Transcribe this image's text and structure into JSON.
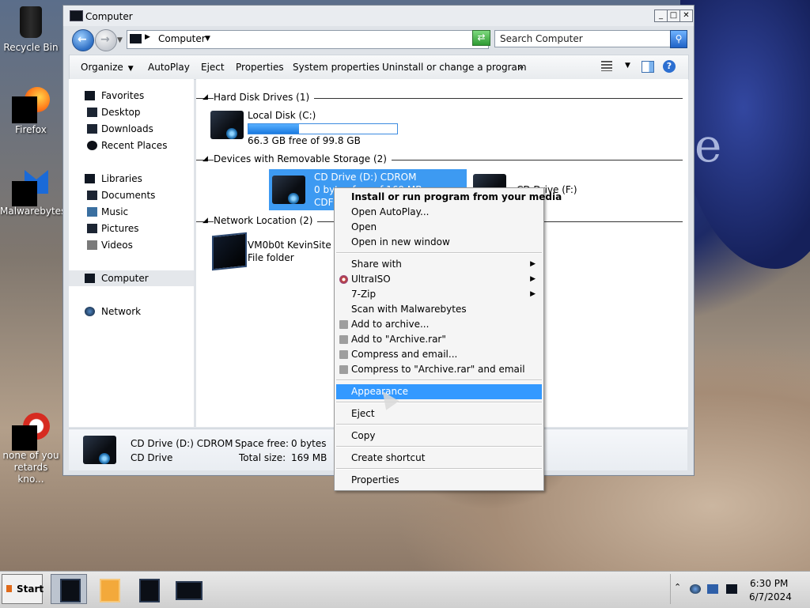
{
  "desktop": {
    "icons": [
      {
        "label": "Recycle Bin"
      },
      {
        "label": "Firefox"
      },
      {
        "label": "Malwarebytes"
      },
      {
        "label": "none of you retards kno..."
      }
    ]
  },
  "window": {
    "title": "Computer",
    "controls": {
      "minimize": "_",
      "maximize": "□",
      "close": "✕"
    },
    "address": {
      "crumb": "Computer"
    },
    "search": {
      "placeholder": "Search Computer"
    },
    "commandbar": {
      "items": [
        "Organize",
        "AutoPlay",
        "Eject",
        "Properties",
        "System properties",
        "Uninstall or change a program"
      ],
      "overflow": "»"
    },
    "navpane": {
      "favorites": "Favorites",
      "favorites_items": [
        "Desktop",
        "Downloads",
        "Recent Places"
      ],
      "libraries": "Libraries",
      "libraries_items": [
        "Documents",
        "Music",
        "Pictures",
        "Videos"
      ],
      "computer": "Computer",
      "network": "Network"
    },
    "groups": {
      "hdd": {
        "header": "Hard Disk Drives (1)",
        "drives": [
          {
            "name": "Local Disk (C:)",
            "free": "66.3 GB free of 99.8 GB",
            "used_fraction": 0.34
          }
        ]
      },
      "removable": {
        "header": "Devices with Removable Storage (2)",
        "drives": [
          {
            "name": "CD Drive (D:) CDROM",
            "free": "0 bytes free of 169 MB",
            "fs": "CDFS"
          },
          {
            "name": "CD Drive (F:)"
          }
        ]
      },
      "network": {
        "header": "Network Location (2)",
        "items": [
          {
            "name": "VM0b0t KevinSite",
            "type": "File folder"
          }
        ]
      }
    },
    "details": {
      "name": "CD Drive (D:) CDROM",
      "type": "CD Drive",
      "space_free_label": "Space free:",
      "space_free": "0 bytes",
      "total_size_label": "Total size:",
      "total_size": "169 MB"
    }
  },
  "context_menu": {
    "items": [
      {
        "label": "Install or run program from your media",
        "bold": true
      },
      {
        "label": "Open AutoPlay..."
      },
      {
        "label": "Open"
      },
      {
        "label": "Open in new window"
      },
      {
        "label": "Share with",
        "submenu": true
      },
      {
        "label": "UltraISO",
        "submenu": true
      },
      {
        "label": "7-Zip",
        "submenu": true
      },
      {
        "label": "Scan with Malwarebytes"
      },
      {
        "label": "Add to archive..."
      },
      {
        "label": "Add to \"Archive.rar\""
      },
      {
        "label": "Compress and email..."
      },
      {
        "label": "Compress to \"Archive.rar\" and email"
      },
      {
        "label": "Appearance",
        "highlighted": true
      },
      {
        "label": "Eject"
      },
      {
        "label": "Copy"
      },
      {
        "label": "Create shortcut"
      },
      {
        "label": "Properties"
      }
    ]
  },
  "taskbar": {
    "start_label": "Start",
    "clock_time": "6:30 PM",
    "clock_date": "6/7/2024"
  },
  "colors": {
    "selection": "#3399ff",
    "tile_selection": "#3d9af2"
  }
}
